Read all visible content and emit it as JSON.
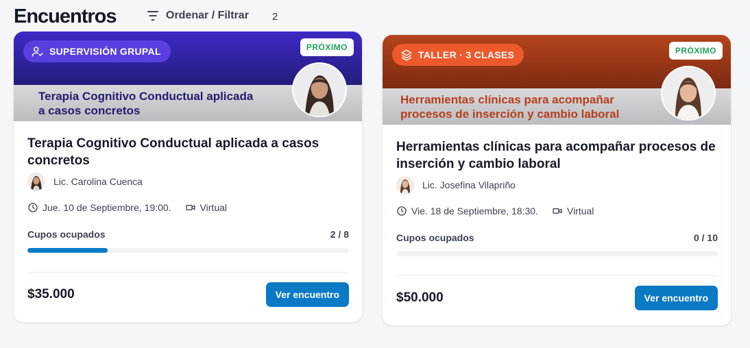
{
  "header": {
    "title": "Encuentros",
    "filter_label": "Ordenar / Filtrar",
    "filter_count": "2"
  },
  "cards": [
    {
      "category": "SUPERVISIÓN GRUPAL",
      "status": "PRÓXIMO",
      "banner_text_line1": "Terapia Cognitivo Conductual aplicada",
      "banner_text_line2": "a casos concretos",
      "title": "Terapia Cognitivo Conductual aplicada a casos concretos",
      "presenter": "Lic. Carolina Cuenca",
      "date": "Jue. 10 de Septiembre, 19:00.",
      "modality": "Virtual",
      "cupos_label": "Cupos ocupados",
      "cupos_value": "2 / 8",
      "cupos_fraction": 0.25,
      "price": "$35.000",
      "cta": "Ver encuentro",
      "accent": "#5a3fe0"
    },
    {
      "category": "TALLER · 3 CLASES",
      "status": "PRÓXIMO",
      "banner_text_line1": "Herramientas clínicas para acompañar",
      "banner_text_line2": "procesos de inserción y cambio laboral",
      "title": "Herramientas clínicas para acompañar procesos de inserción y cambio laboral",
      "presenter": "Lic. Josefina Vilapriño",
      "date": "Vie. 18 de Septiembre, 18:30.",
      "modality": "Virtual",
      "cupos_label": "Cupos ocupados",
      "cupos_value": "0 / 10",
      "cupos_fraction": 0,
      "price": "$50.000",
      "cta": "Ver encuentro",
      "accent": "#ec5a2c"
    }
  ],
  "colors": {
    "primary_button": "#0a7ac4",
    "status_green": "#1fa35c",
    "progress_fill": "#0c7cc9"
  }
}
